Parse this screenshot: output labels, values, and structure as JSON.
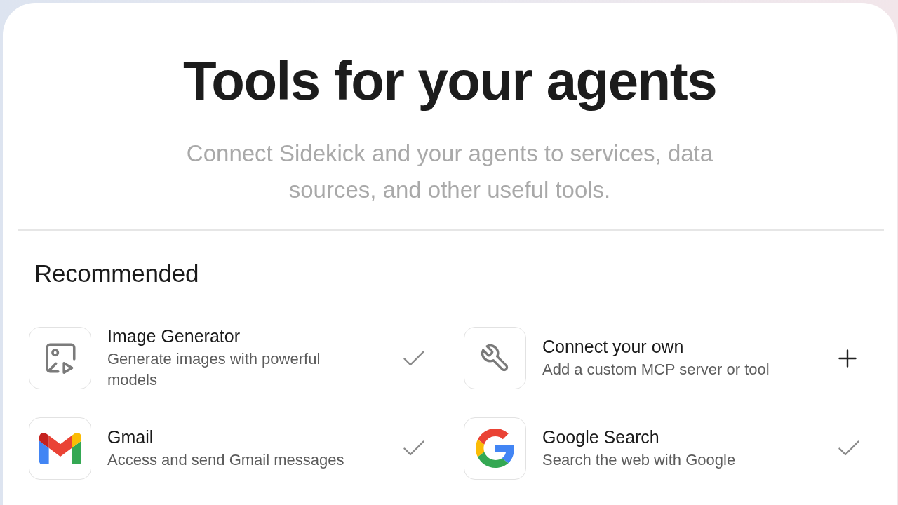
{
  "header": {
    "title": "Tools for your agents",
    "subtitle": "Connect Sidekick and your agents to services, data sources, and other useful tools."
  },
  "section": {
    "heading": "Recommended",
    "tools": [
      {
        "name": "Image Generator",
        "description": "Generate images with powerful models",
        "added": true
      },
      {
        "name": "Connect your own",
        "description": "Add a custom MCP server or tool",
        "added": false
      },
      {
        "name": "Gmail",
        "description": "Access and send Gmail messages",
        "added": true
      },
      {
        "name": "Google Search",
        "description": "Search the web with Google",
        "added": true
      }
    ]
  }
}
